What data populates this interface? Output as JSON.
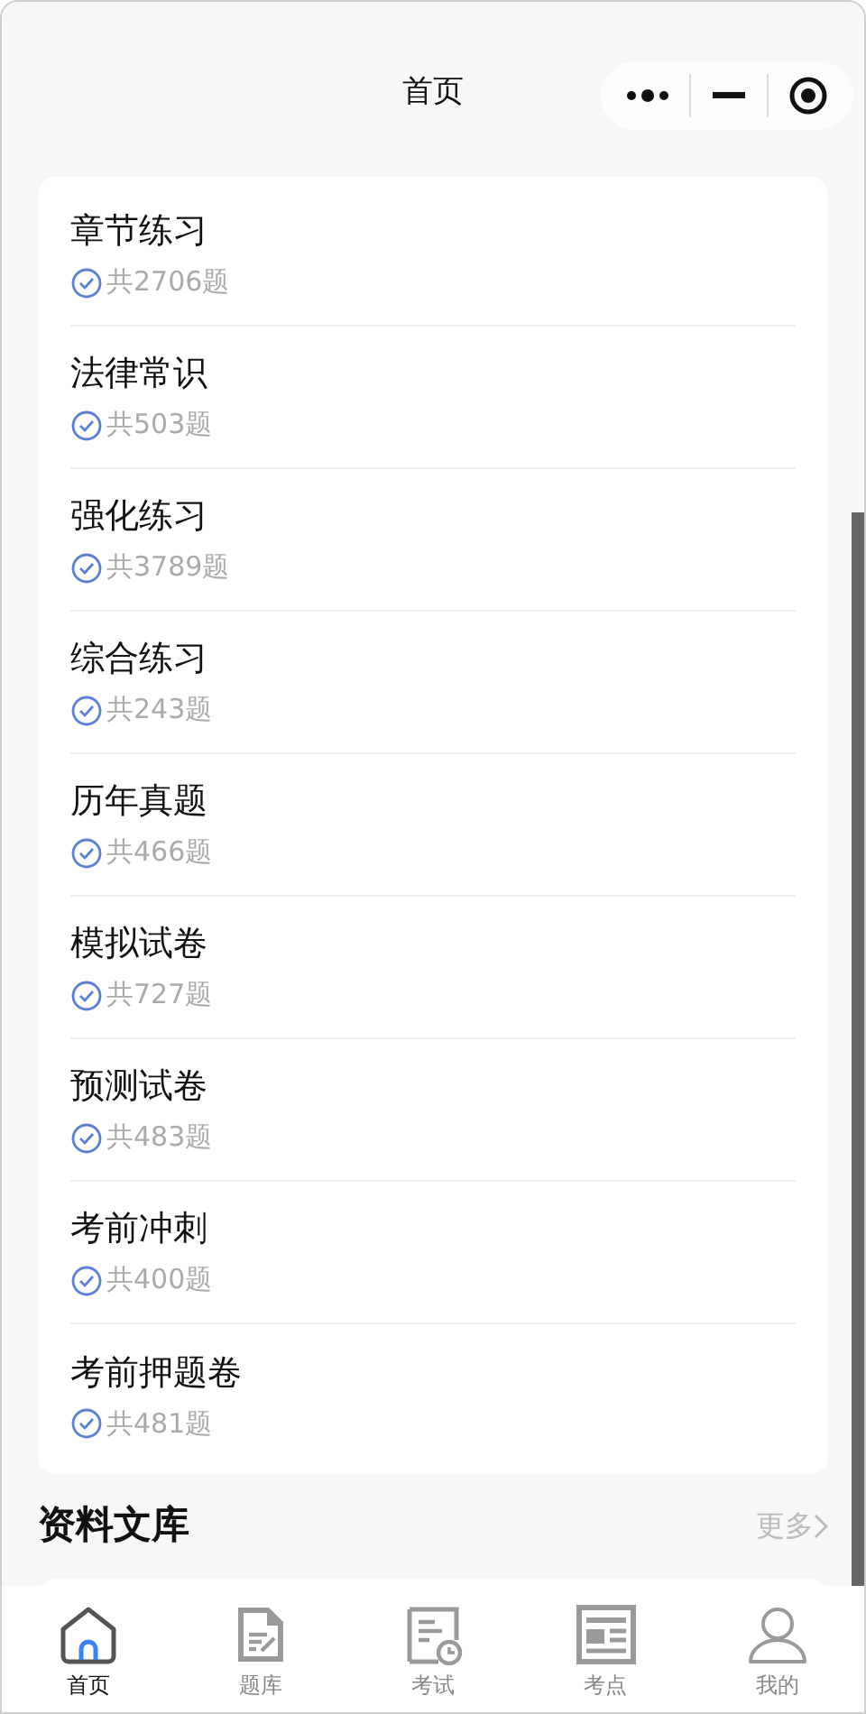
{
  "header": {
    "title": "首页"
  },
  "practice_list": [
    {
      "name": "章节练习",
      "count": "共2706题"
    },
    {
      "name": "法律常识",
      "count": "共503题"
    },
    {
      "name": "强化练习",
      "count": "共3789题"
    },
    {
      "name": "综合练习",
      "count": "共243题"
    },
    {
      "name": "历年真题",
      "count": "共466题"
    },
    {
      "name": "模拟试卷",
      "count": "共727题"
    },
    {
      "name": "预测试卷",
      "count": "共483题"
    },
    {
      "name": "考前冲刺",
      "count": "共400题"
    },
    {
      "name": "考前押题卷",
      "count": "共481题"
    }
  ],
  "library_section": {
    "title": "资料文库",
    "more": "更多"
  },
  "tab_bar": [
    {
      "label": "首页",
      "kind": "home",
      "selected": true
    },
    {
      "label": "题库",
      "kind": "bank",
      "selected": false
    },
    {
      "label": "考试",
      "kind": "exam",
      "selected": false
    },
    {
      "label": "考点",
      "kind": "points",
      "selected": false
    },
    {
      "label": "我的",
      "kind": "me",
      "selected": false
    }
  ]
}
